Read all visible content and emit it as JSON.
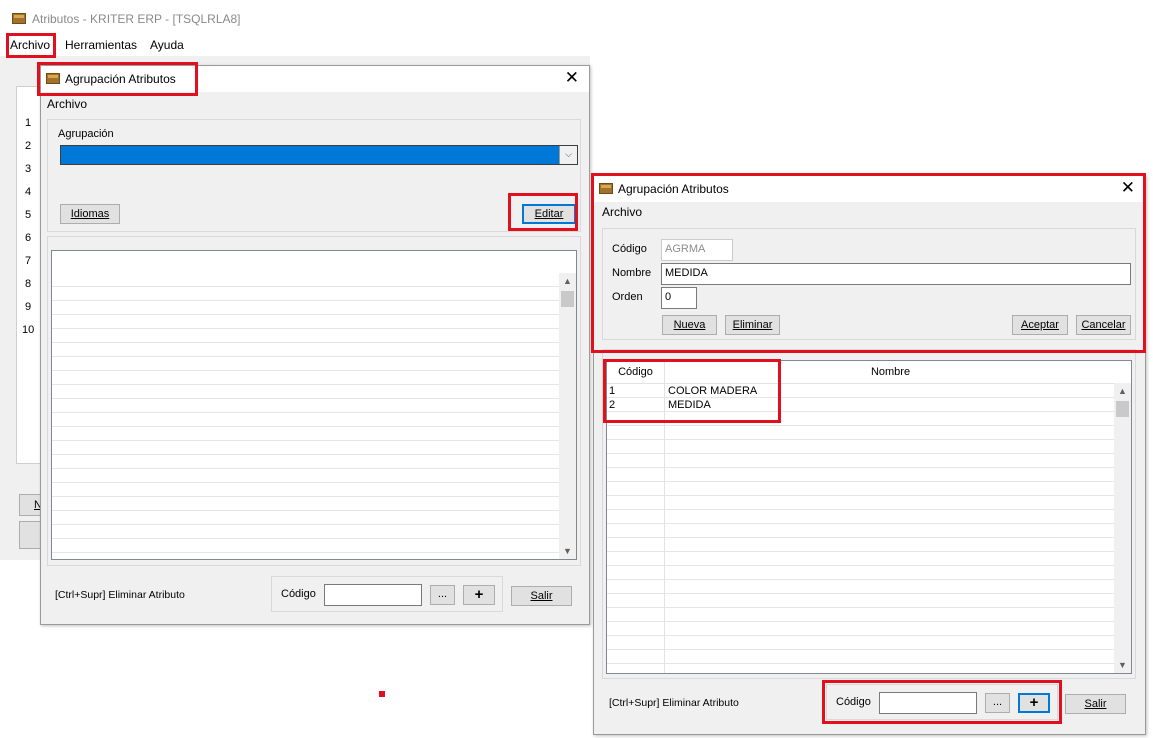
{
  "main_window": {
    "title": "Atributos - KRITER ERP - [TSQLRLA8]",
    "menu": {
      "archivo": "Archivo",
      "herramientas": "Herramientas",
      "ayuda": "Ayuda"
    },
    "row_numbers": [
      "1",
      "2",
      "3",
      "4",
      "5",
      "6",
      "7",
      "8",
      "9",
      "10"
    ],
    "side_button_label": "N"
  },
  "dialog_left": {
    "title": "Agrupación Atributos",
    "menu_archivo": "Archivo",
    "agrupacion_label": "Agrupación",
    "agrupacion_value": "",
    "btn_idiomas": "Idiomas",
    "btn_editar": "Editar",
    "footer_hint": "[Ctrl+Supr] Eliminar Atributo",
    "codigo_label": "Código",
    "codigo_value": "",
    "btn_dots": "...",
    "btn_plus": "+",
    "btn_salir": "Salir"
  },
  "dialog_right": {
    "title": "Agrupación Atributos",
    "menu_archivo": "Archivo",
    "form": {
      "codigo_label": "Código",
      "codigo_value": "AGRMA",
      "nombre_label": "Nombre",
      "nombre_value": "MEDIDA",
      "orden_label": "Orden",
      "orden_value": "0"
    },
    "btn_nueva": "Nueva",
    "btn_eliminar": "Eliminar",
    "btn_aceptar": "Aceptar",
    "btn_cancelar": "Cancelar",
    "table": {
      "headers": [
        "Código",
        "Nombre"
      ],
      "rows": [
        {
          "codigo": "1",
          "nombre": "COLOR MADERA"
        },
        {
          "codigo": "2",
          "nombre": "MEDIDA"
        }
      ]
    },
    "footer_hint": "[Ctrl+Supr] Eliminar Atributo",
    "codigo_label": "Código",
    "codigo_value": "",
    "btn_dots": "...",
    "btn_plus": "+",
    "btn_salir": "Salir"
  },
  "colors": {
    "highlight": "#e0101f",
    "selection": "#0078d7",
    "window_bg": "#f0f0f0"
  },
  "icons": [
    "box-icon",
    "close-icon",
    "chevron-down-icon",
    "chevron-up-icon"
  ]
}
